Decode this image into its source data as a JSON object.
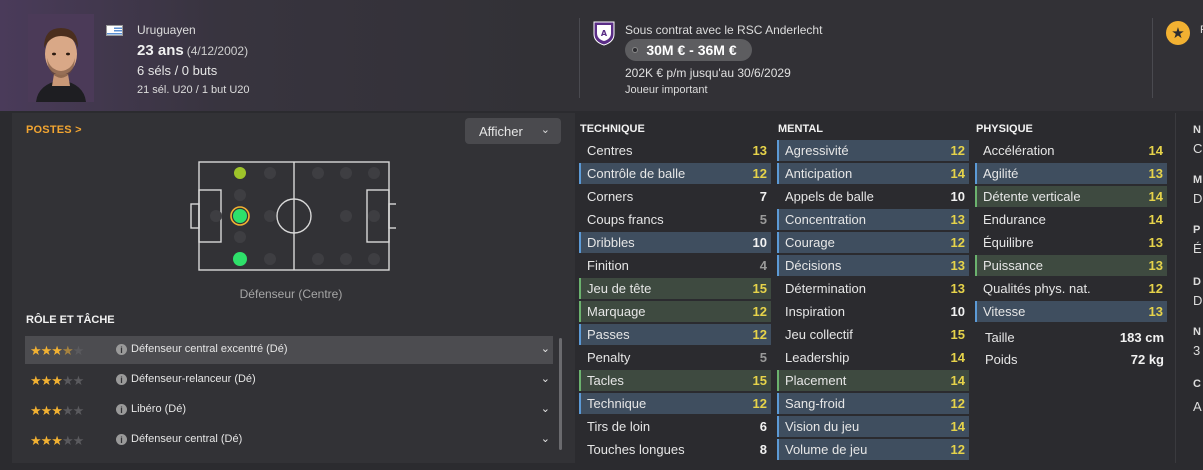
{
  "header": {
    "nationality": "Uruguayen",
    "age": "23 ans",
    "dob": "(4/12/2002)",
    "caps": "6 séls / 0 buts",
    "u20": "21 sél. U20 / 1 but U20",
    "contract": "Sous contrat avec le RSC Anderlecht",
    "value": "30M € - 36M €",
    "wage": "202K € p/m jusqu'au 30/6/2029",
    "status": "Joueur important",
    "right_partial": "R"
  },
  "positions": {
    "title": "POSTES >",
    "display_button": "Afficher",
    "position_label": "Défenseur (Centre)"
  },
  "roles": {
    "title": "RÔLE ET TÂCHE",
    "items": [
      {
        "stars": 3.5,
        "name": "Défenseur central excentré (Dé)"
      },
      {
        "stars": 3,
        "name": "Défenseur-relanceur (Dé)"
      },
      {
        "stars": 3,
        "name": "Libéro (Dé)"
      },
      {
        "stars": 3,
        "name": "Défenseur central (Dé)"
      }
    ]
  },
  "technique": {
    "title": "TECHNIQUE",
    "attrs": [
      {
        "name": "Centres",
        "value": "13"
      },
      {
        "name": "Contrôle de balle",
        "value": "12"
      },
      {
        "name": "Corners",
        "value": "7"
      },
      {
        "name": "Coups francs",
        "value": "5"
      },
      {
        "name": "Dribbles",
        "value": "10"
      },
      {
        "name": "Finition",
        "value": "4"
      },
      {
        "name": "Jeu de tête",
        "value": "15"
      },
      {
        "name": "Marquage",
        "value": "12"
      },
      {
        "name": "Passes",
        "value": "12"
      },
      {
        "name": "Penalty",
        "value": "5"
      },
      {
        "name": "Tacles",
        "value": "15"
      },
      {
        "name": "Technique",
        "value": "12"
      },
      {
        "name": "Tirs de loin",
        "value": "6"
      },
      {
        "name": "Touches longues",
        "value": "8"
      }
    ]
  },
  "mental": {
    "title": "MENTAL",
    "attrs": [
      {
        "name": "Agressivité",
        "value": "12"
      },
      {
        "name": "Anticipation",
        "value": "14"
      },
      {
        "name": "Appels de balle",
        "value": "10"
      },
      {
        "name": "Concentration",
        "value": "13"
      },
      {
        "name": "Courage",
        "value": "12"
      },
      {
        "name": "Décisions",
        "value": "13"
      },
      {
        "name": "Détermination",
        "value": "13"
      },
      {
        "name": "Inspiration",
        "value": "10"
      },
      {
        "name": "Jeu collectif",
        "value": "15"
      },
      {
        "name": "Leadership",
        "value": "14"
      },
      {
        "name": "Placement",
        "value": "14"
      },
      {
        "name": "Sang-froid",
        "value": "12"
      },
      {
        "name": "Vision du jeu",
        "value": "14"
      },
      {
        "name": "Volume de jeu",
        "value": "12"
      }
    ]
  },
  "physique": {
    "title": "PHYSIQUE",
    "attrs": [
      {
        "name": "Accélération",
        "value": "14"
      },
      {
        "name": "Agilité",
        "value": "13"
      },
      {
        "name": "Détente verticale",
        "value": "14"
      },
      {
        "name": "Endurance",
        "value": "14"
      },
      {
        "name": "Équilibre",
        "value": "13"
      },
      {
        "name": "Puissance",
        "value": "13"
      },
      {
        "name": "Qualités phys. nat.",
        "value": "12"
      },
      {
        "name": "Vitesse",
        "value": "13"
      }
    ],
    "height_label": "Taille",
    "height_value": "183 cm",
    "weight_label": "Poids",
    "weight_value": "72 kg"
  },
  "right_partial": {
    "items": [
      {
        "label": "N",
        "value": "C"
      },
      {
        "label": "M",
        "value": "D"
      },
      {
        "label": "P",
        "value": "É"
      },
      {
        "label": "D",
        "value": "D"
      },
      {
        "label": "N",
        "value": "3"
      },
      {
        "label": "C",
        "value": "A"
      }
    ]
  },
  "colors": {
    "accent_orange": "#f2a531",
    "star": "#f2b132",
    "value_yellow": "#e6d34a",
    "highlight_blue": "#3f4e5f",
    "highlight_green": "#3e4a40",
    "pitch_dot_green": "#2ee06a"
  }
}
